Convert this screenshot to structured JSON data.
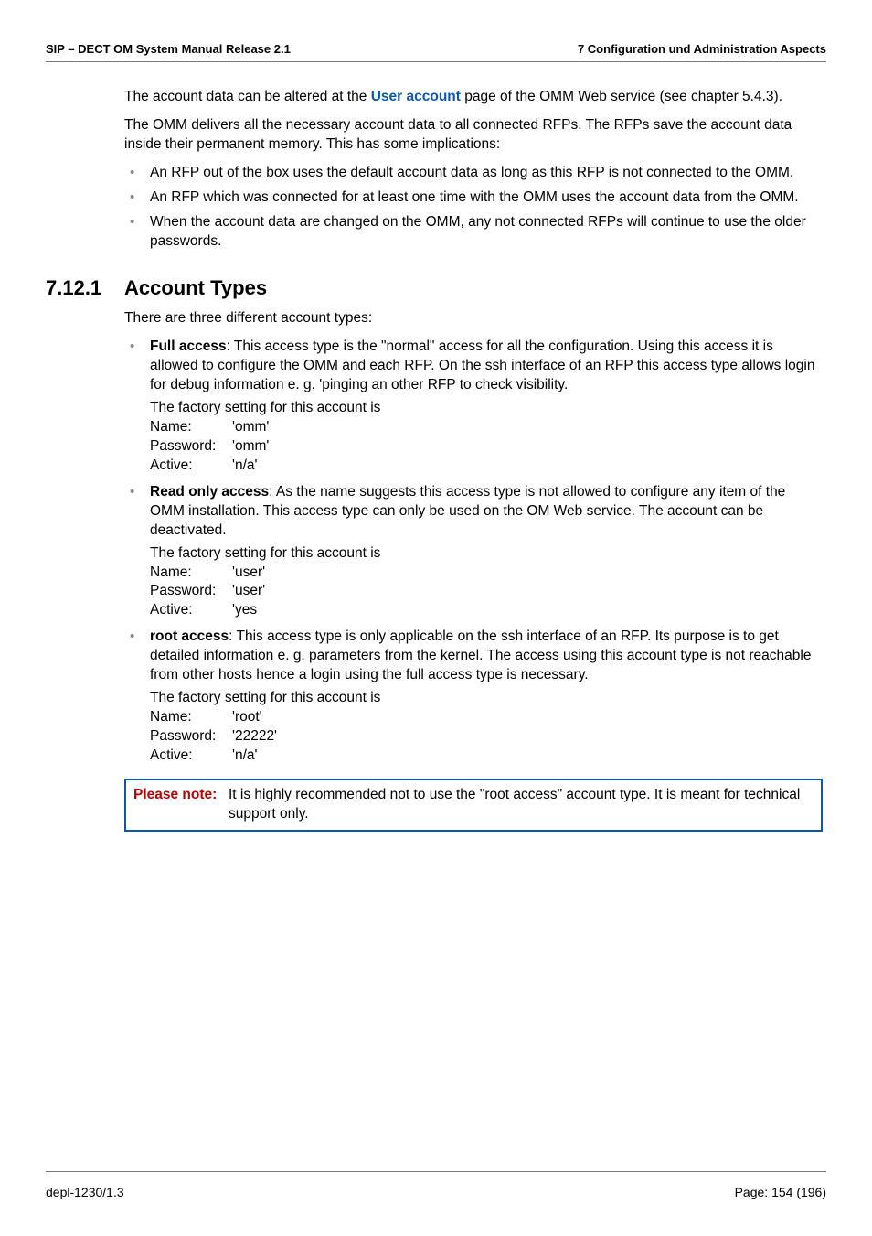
{
  "header": {
    "left": "SIP – DECT OM System Manual Release 2.1",
    "right": "7 Configuration und Administration Aspects"
  },
  "intro": {
    "p1_a": "The account data can be altered at the ",
    "p1_link": "User account",
    "p1_b": " page of the OMM Web service (see chapter 5.4.3).",
    "p2": "The OMM delivers all the necessary account data to all connected RFPs. The RFPs save the account data inside their permanent memory. This has some implications:",
    "bullets": [
      "An RFP out of the box uses the default account data as long as this RFP is not connected to the OMM.",
      "An RFP which was connected for at least one time with the OMM uses the account data from the OMM.",
      "When the account data are changed on the OMM, any not connected RFPs will continue to use the older passwords."
    ]
  },
  "section": {
    "num": "7.12.1",
    "title": "Account Types",
    "intro": "There are three different account types:",
    "items": [
      {
        "lead": "Full access",
        "desc": ": This access type is the \"normal\" access for all the configuration. Using this access it is allowed to configure the OMM and each RFP. On the ssh interface of an RFP this access type allows login for debug information e. g. 'pinging an other RFP to check visibility.",
        "factory": "The factory setting for this account is",
        "name_lbl": "Name:",
        "name_val": "'omm'",
        "pass_lbl": "Password:",
        "pass_val": "'omm'",
        "active_lbl": "Active:",
        "active_val": "'n/a'"
      },
      {
        "lead": "Read only access",
        "desc": ": As the name suggests this access type is not allowed to configure any item of the OMM installation. This access type can only be used on the OM Web service. The account can be deactivated.",
        "factory": "The factory setting for this account is",
        "name_lbl": "Name:",
        "name_val": "'user'",
        "pass_lbl": "Password:",
        "pass_val": "'user'",
        "active_lbl": "Active:",
        "active_val": "'yes"
      },
      {
        "lead": "root access",
        "desc": ": This access type is only applicable on the ssh interface of an RFP. Its purpose is to get detailed information e. g. parameters from the kernel. The access using this account type is not reachable from other hosts hence a login using the full access type is necessary.",
        "factory": "The factory setting for this account is",
        "name_lbl": "Name:",
        "name_val": "'root'",
        "pass_lbl": "Password:",
        "pass_val": "'22222'",
        "active_lbl": "Active:",
        "active_val": "'n/a'"
      }
    ],
    "note": {
      "label": "Please note:",
      "text": "It is highly recommended not to use the \"root access\" account type. It is meant for technical support only."
    }
  },
  "footer": {
    "left": "depl-1230/1.3",
    "right": "Page: 154 (196)"
  }
}
